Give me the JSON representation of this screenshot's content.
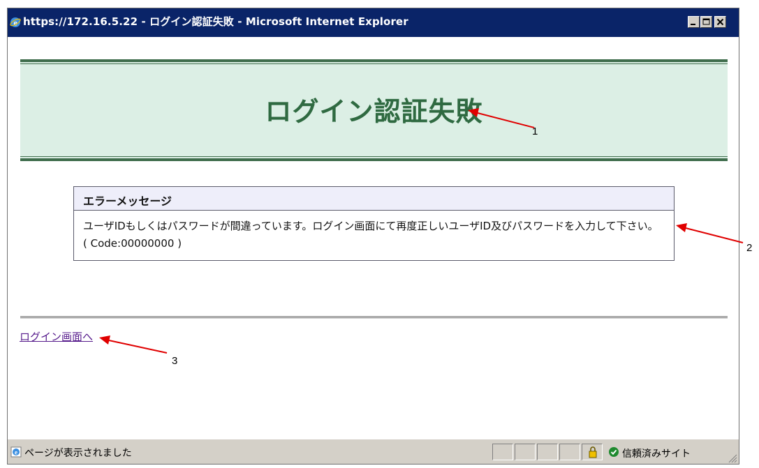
{
  "window": {
    "title": "https://172.16.5.22 - ログイン認証失敗 - Microsoft Internet Explorer"
  },
  "page": {
    "heading": "ログイン認証失敗",
    "error_box": {
      "header": "エラーメッセージ",
      "message": "ユーザIDもしくはパスワードが間違っています。ログイン画面にて再度正しいユーザID及びパスワードを入力して下さい。",
      "code": "( Code:00000000 )"
    },
    "link_label": "ログイン画面へ"
  },
  "status_bar": {
    "text": "ページが表示されました",
    "zone": "信頼済みサイト"
  },
  "annotations": [
    "1",
    "2",
    "3"
  ],
  "colors": {
    "titlebar": "#0a2468",
    "banner_bg": "#dcefe5",
    "banner_border": "#3f6d4c",
    "heading": "#2f6a41",
    "annotation_arrow": "#e00000"
  },
  "icons": [
    "ie-logo-icon",
    "minimize-icon",
    "maximize-icon",
    "close-icon",
    "lock-icon",
    "trusted-site-check-icon",
    "resize-grip-icon"
  ]
}
